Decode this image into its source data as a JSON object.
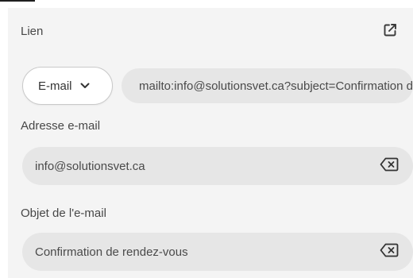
{
  "link_section": {
    "title": "Lien",
    "open_link_icon": "external-link-icon"
  },
  "link_type": {
    "selected": "E-mail",
    "icon": "chevron-down-icon"
  },
  "url": {
    "value": "mailto:info@solutionsvet.ca?subject=Confirmation de rendez-vous"
  },
  "email_address": {
    "label": "Adresse e-mail",
    "value": "info@solutionsvet.ca",
    "clear_icon": "backspace-clear-icon"
  },
  "email_subject": {
    "label": "Objet de l'e-mail",
    "value": "Confirmation de rendez-vous",
    "clear_icon": "backspace-clear-icon"
  },
  "colors": {
    "panel_background": "#f4f4f4",
    "field_background": "#e6e6e6",
    "select_background": "#ffffff",
    "text": "#4a4a4a"
  }
}
